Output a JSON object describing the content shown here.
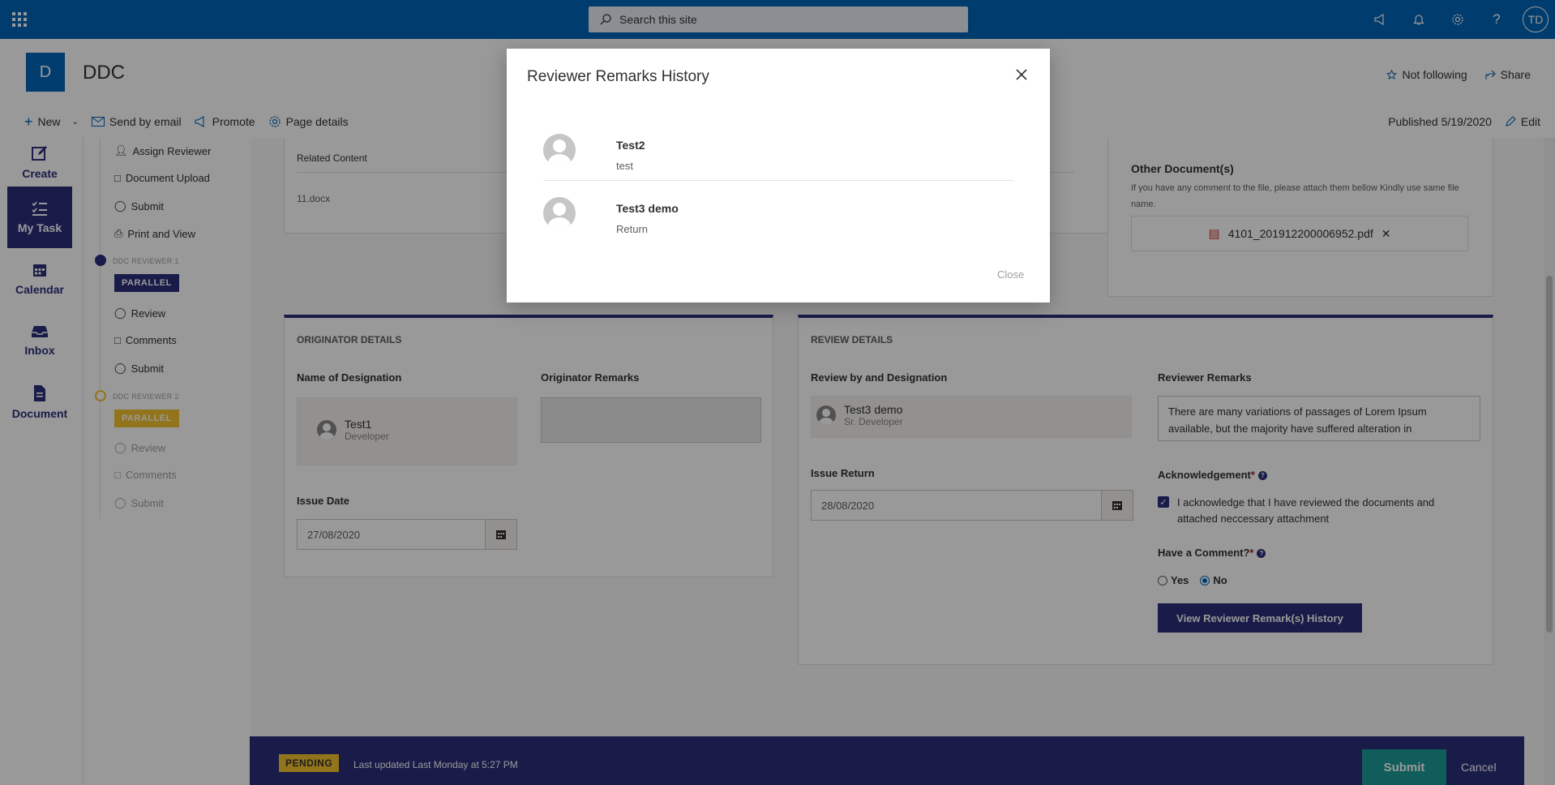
{
  "suite": {
    "search_placeholder": "Search this site",
    "user_initials": "TD"
  },
  "site": {
    "logo_letter": "D",
    "title": "DDC",
    "not_following": "Not following",
    "share": "Share"
  },
  "commandbar": {
    "new": "New",
    "send_by_email": "Send by email",
    "promote": "Promote",
    "page_details": "Page details",
    "published": "Published 5/19/2020",
    "edit": "Edit"
  },
  "leftrail": {
    "create": "Create",
    "my_task": "My Task",
    "calendar": "Calendar",
    "inbox": "Inbox",
    "document": "Document"
  },
  "steps": {
    "assign_reviewer": "Assign Reviewer",
    "document_upload": "Document Upload",
    "submit": "Submit",
    "print_and_view": "Print and View",
    "stage1": "DDC REVIEWER 1",
    "parallel": "PARALLEL",
    "review": "Review",
    "comments": "Comments",
    "stage2": "DDC REVIEWER 2"
  },
  "related": {
    "header": "Related Content",
    "file": "11.docx"
  },
  "other_docs": {
    "title": "Other Document(s)",
    "hint": "If you have any comment to the file, please attach them bellow Kindly use same file name.",
    "file": "4101_201912200006952.pdf"
  },
  "originator": {
    "section": "ORIGINATOR DETAILS",
    "name_label": "Name of Designation",
    "remarks_label": "Originator Remarks",
    "person_name": "Test1",
    "person_role": "Developer",
    "issue_date_label": "Issue Date",
    "issue_date": "27/08/2020"
  },
  "review": {
    "section": "REVIEW DETAILS",
    "by_label": "Review by and Designation",
    "person_name": "Test3 demo",
    "person_role": "Sr. Developer",
    "remarks_label": "Reviewer Remarks",
    "remarks_text": "There are many variations of passages of Lorem Ipsum available, but the majority have suffered alteration in",
    "issue_return_label": "Issue Return",
    "issue_return": "28/08/2020",
    "ack_label": "Acknowledgement",
    "ack_text": "I acknowledge that I have reviewed the documents and attached neccessary attachment",
    "comment_label": "Have a Comment?",
    "yes": "Yes",
    "no": "No",
    "history_button": "View Reviewer Remark(s) History"
  },
  "status": {
    "badge": "PENDING",
    "updated": "Last updated Last Monday at 5:27 PM",
    "submit": "Submit",
    "cancel": "Cancel"
  },
  "modal": {
    "title": "Reviewer Remarks History",
    "close_label": "Close",
    "remarks": [
      {
        "name": "Test2",
        "text": "test"
      },
      {
        "name": "Test3 demo",
        "text": "Return"
      }
    ]
  },
  "colors": {
    "brand": "#0364b8",
    "accent": "#2b2f7a",
    "pending": "#f2c12e",
    "submit": "#1b9b9a"
  }
}
